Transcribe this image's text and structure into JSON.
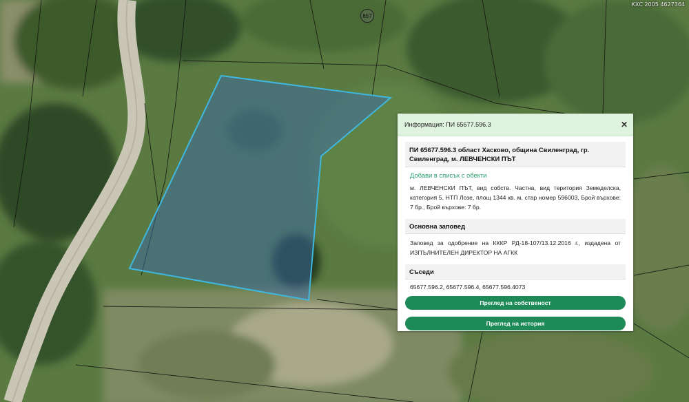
{
  "map": {
    "coordinates_label": "КХС 2005 4627364",
    "marker_label": "857",
    "parcel_highlight_color": "#3fb8e0"
  },
  "info_panel": {
    "header_title": "Информация: ПИ 65677.596.3",
    "close_icon": "close-icon",
    "parcel_title": "ПИ 65677.596.3 област Хасково, община Свиленград, гр. Свиленград, м. ЛЕВЧЕНСКИ ПЪТ",
    "add_to_list_link": "Добави в списък с обекти",
    "description": "м. ЛЕВЧЕНСКИ ПЪТ, вид собств. Частна, вид територия Земеделска, категория 5, НТП Лозе, площ 1344 кв. м, стар номер 596003, Брой върхове: 7 бр., Брой върхове: 7 бр.",
    "order_heading": "Основна заповед",
    "order_text": "Заповед за одобрение на КККР РД-18-107/13.12.2016 г., издадена от ИЗПЪЛНИТЕЛЕН ДИРЕКТОР НА АГКК",
    "neighbors_heading": "Съседи",
    "neighbors_text": "65677.596.2, 65677.596.4, 65677.596.4073",
    "ownership_button": "Преглед на собственост",
    "history_button": "Преглед на история"
  },
  "colors": {
    "accent": "#1d8a57",
    "link": "#2a9e6d",
    "header_bg": "#dff3df"
  }
}
